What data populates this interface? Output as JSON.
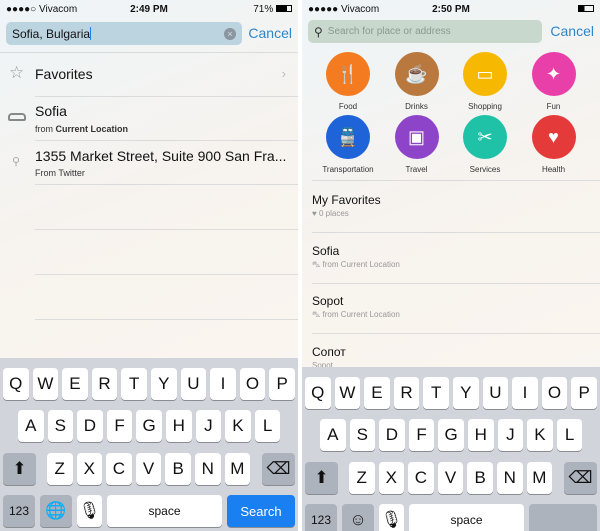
{
  "left": {
    "status": {
      "carrier": "●●●●○ Vivacom",
      "time": "2:49 PM",
      "battery": "71%"
    },
    "search": {
      "value": "Sofia, Bulgaria",
      "cancel": "Cancel"
    },
    "rows": [
      {
        "title": "Favorites",
        "icon": "star-icon"
      },
      {
        "title": "Sofia",
        "sub_prefix": "from ",
        "sub_bold": "Current Location",
        "icon": "car-icon"
      },
      {
        "title": "1355 Market Street, Suite 900 San Fra...",
        "sub": "From Twitter",
        "icon": "search-icon"
      }
    ],
    "keyboard": {
      "return": "Search",
      "globe": "globe-icon"
    }
  },
  "right": {
    "status": {
      "carrier": "●●●●● Vivacom",
      "time": "2:50 PM"
    },
    "search": {
      "placeholder": "Search for place or address",
      "cancel": "Cancel"
    },
    "categories": [
      {
        "label": "Food",
        "color": "#f47b20",
        "icon": "fork-knife-icon"
      },
      {
        "label": "Drinks",
        "color": "#b9783e",
        "icon": "coffee-cup-icon"
      },
      {
        "label": "Shopping",
        "color": "#f6b800",
        "icon": "bag-icon"
      },
      {
        "label": "Fun",
        "color": "#e83fa8",
        "icon": "ticket-icon"
      },
      {
        "label": "Transportation",
        "color": "#1f63d8",
        "icon": "car-train-icon"
      },
      {
        "label": "Travel",
        "color": "#8e44c9",
        "icon": "suitcase-icon"
      },
      {
        "label": "Services",
        "color": "#1fc2a6",
        "icon": "scissors-icon"
      },
      {
        "label": "Health",
        "color": "#e53a3a",
        "icon": "heart-icon"
      }
    ],
    "rows": [
      {
        "title": "My Favorites",
        "sub": "0 places",
        "icon": "heart-icon"
      },
      {
        "title": "Sofia",
        "sub": "from Current Location",
        "icon": "car-icon"
      },
      {
        "title": "Sopot",
        "sub": "from Current Location",
        "icon": "car-icon"
      },
      {
        "title": "Сопот",
        "sub": "Sopot"
      }
    ],
    "keyboard": {
      "emoji": "emoji-icon"
    }
  },
  "keys": {
    "row1": [
      "Q",
      "W",
      "E",
      "R",
      "T",
      "Y",
      "U",
      "I",
      "O",
      "P"
    ],
    "row2": [
      "A",
      "S",
      "D",
      "F",
      "G",
      "H",
      "J",
      "K",
      "L"
    ],
    "row3": [
      "Z",
      "X",
      "C",
      "V",
      "B",
      "N",
      "M"
    ],
    "num": "123",
    "space": "space"
  }
}
